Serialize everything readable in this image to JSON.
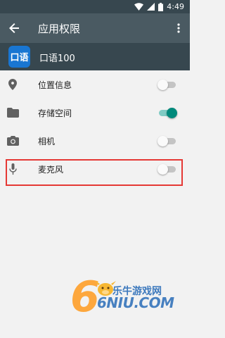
{
  "status_bar": {
    "time": "4:49"
  },
  "toolbar": {
    "title": "应用权限"
  },
  "app": {
    "name": "口语100",
    "icon_label": "口语"
  },
  "permissions": [
    {
      "label": "位置信息",
      "icon": "location-pin-icon",
      "enabled": false
    },
    {
      "label": "存储空间",
      "icon": "folder-icon",
      "enabled": true
    },
    {
      "label": "相机",
      "icon": "camera-icon",
      "enabled": false
    },
    {
      "label": "麦克风",
      "icon": "microphone-icon",
      "enabled": false
    }
  ],
  "watermark": {
    "brand": "乐牛游戏网",
    "logo_text": "6NIU.COM"
  },
  "colors": {
    "status_bar": "#37474f",
    "toolbar": "#4a5a62",
    "accent": "#00897b",
    "highlight": "#e53935",
    "background": "#f2f2f2"
  }
}
